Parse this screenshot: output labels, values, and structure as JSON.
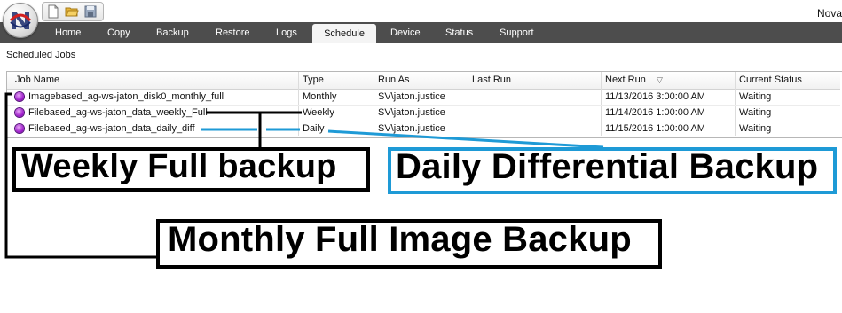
{
  "window": {
    "title": "Nova"
  },
  "toolbar": {
    "icons": [
      "new-document-icon",
      "open-folder-icon",
      "save-disk-icon"
    ]
  },
  "menu": {
    "items": [
      "Home",
      "Copy",
      "Backup",
      "Restore",
      "Logs",
      "Schedule",
      "Device",
      "Status",
      "Support"
    ],
    "active": "Schedule"
  },
  "section": {
    "label": "Scheduled Jobs"
  },
  "table": {
    "columns": [
      "Job Name",
      "Type",
      "Run As",
      "Last Run",
      "Next Run",
      "Current Status"
    ],
    "sort_indicator": "▽",
    "rows": [
      {
        "job_name": "Imagebased_ag-ws-jaton_disk0_monthly_full",
        "type": "Monthly",
        "run_as": "SV\\jaton.justice",
        "last_run": "",
        "next_run": "11/13/2016 3:00:00 AM",
        "status": "Waiting"
      },
      {
        "job_name": "Filebased_ag-ws-jaton_data_weekly_Full",
        "type": "Weekly",
        "run_as": "SV\\jaton.justice",
        "last_run": "",
        "next_run": "11/14/2016 1:00:00 AM",
        "status": "Waiting"
      },
      {
        "job_name": "Filebased_ag-ws-jaton_data_daily_diff",
        "type": "Daily",
        "run_as": "SV\\jaton.justice",
        "last_run": "",
        "next_run": "11/15/2016 1:00:00 AM",
        "status": "Waiting"
      }
    ]
  },
  "annotations": {
    "weekly": "Weekly Full backup",
    "daily": "Daily Differential Backup",
    "monthly": "Monthly Full Image Backup"
  },
  "colors": {
    "menu_bar": "#4d4d4d",
    "annotation_blue": "#1e9ad6",
    "annotation_black": "#000000",
    "row_icon": "#9b16c9"
  }
}
